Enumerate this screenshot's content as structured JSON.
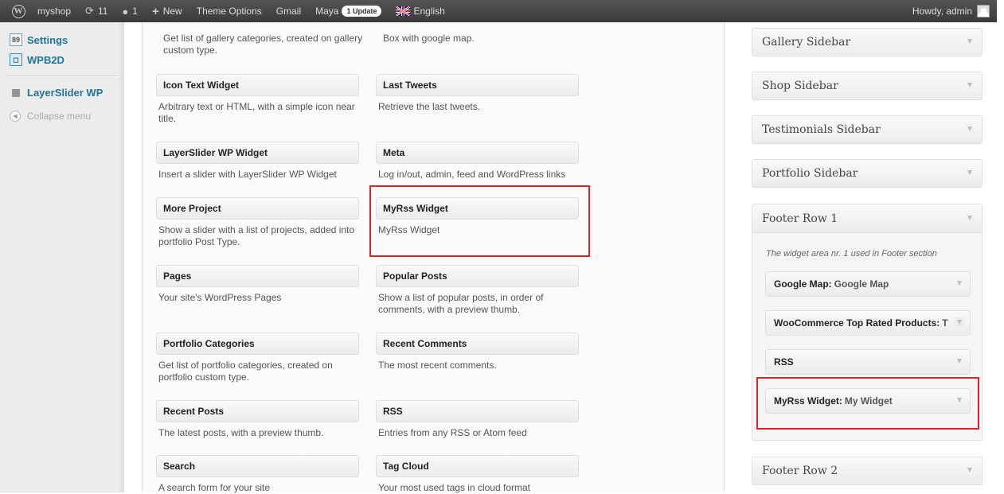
{
  "adminbar": {
    "site_name": "myshop",
    "updates_count": "11",
    "comments_count": "1",
    "new_label": "New",
    "theme_options": "Theme Options",
    "gmail": "Gmail",
    "maya": "Maya",
    "maya_badge": "1 Update",
    "language": "English",
    "howdy": "Howdy, admin"
  },
  "menu": {
    "settings": "Settings",
    "wpb2d": "WPB2D",
    "layerslider": "LayerSlider WP",
    "collapse": "Collapse menu"
  },
  "widgets": {
    "top_left_desc": "Get list of gallery categories, created on gallery custom type.",
    "top_right_desc": "Box with google map.",
    "items": [
      {
        "title": "Icon Text Widget",
        "desc": "Arbitrary text or HTML, with a simple icon near title."
      },
      {
        "title": "Last Tweets",
        "desc": "Retrieve the last tweets."
      },
      {
        "title": "LayerSlider WP Widget",
        "desc": "Insert a slider with LayerSlider WP Widget"
      },
      {
        "title": "Meta",
        "desc": "Log in/out, admin, feed and WordPress links"
      },
      {
        "title": "More Project",
        "desc": "Show a slider with a list of projects, added into portfolio Post Type."
      },
      {
        "title": "MyRss Widget",
        "desc": "MyRss Widget"
      },
      {
        "title": "Pages",
        "desc": "Your site's WordPress Pages"
      },
      {
        "title": "Popular Posts",
        "desc": "Show a list of popular posts, in order of comments, with a preview thumb."
      },
      {
        "title": "Portfolio Categories",
        "desc": "Get list of portfolio categories, created on portfolio custom type."
      },
      {
        "title": "Recent Comments",
        "desc": "The most recent comments."
      },
      {
        "title": "Recent Posts",
        "desc": "The latest posts, with a preview thumb."
      },
      {
        "title": "RSS",
        "desc": "Entries from any RSS or Atom feed"
      },
      {
        "title": "Search",
        "desc": "A search form for your site"
      },
      {
        "title": "Tag Cloud",
        "desc": "Your most used tags in cloud format"
      }
    ]
  },
  "sidebars": {
    "gallery": "Gallery Sidebar",
    "shop": "Shop Sidebar",
    "testimonials": "Testimonials Sidebar",
    "portfolio": "Portfolio Sidebar",
    "footer_row1": "Footer Row 1",
    "footer_row1_desc": "The widget area nr. 1 used in Footer section",
    "footer_widgets": [
      {
        "name": "Google Map:",
        "title": "Google Map"
      },
      {
        "name": "WooCommerce Top Rated Products:",
        "title": "T"
      },
      {
        "name": "RSS",
        "title": ""
      },
      {
        "name": "MyRss Widget:",
        "title": "My Widget"
      }
    ],
    "footer_row2": "Footer Row 2"
  },
  "colors": {
    "adminbar_bg": "#464646",
    "link": "#21759b",
    "highlight": "#d9242a"
  }
}
